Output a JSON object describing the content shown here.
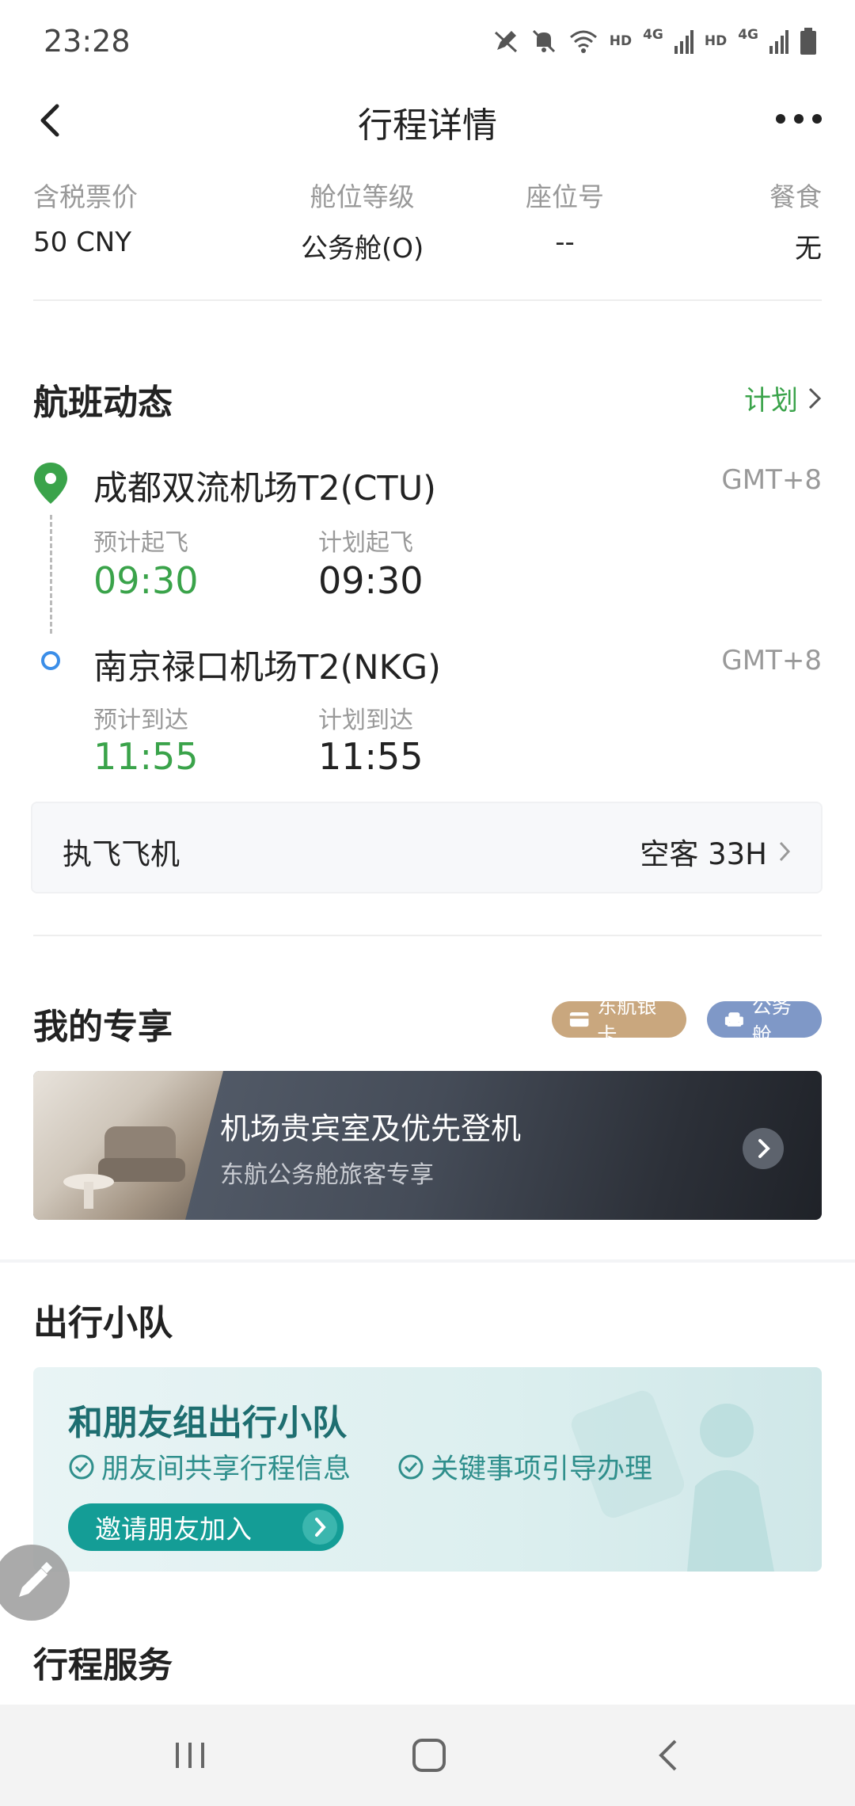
{
  "status_bar": {
    "time": "23:28",
    "icons": [
      "pen-icon",
      "mute-icon",
      "wifi-icon",
      "signal-icon",
      "signal-icon",
      "battery-icon"
    ],
    "hd1": "HD",
    "net1": "4G",
    "hd2": "HD",
    "net2": "4G"
  },
  "header": {
    "title": "行程详情"
  },
  "ticket": {
    "price_label": "含税票价",
    "price_value": "50 CNY",
    "class_label": "舱位等级",
    "class_value": "公务舱(O)",
    "seat_label": "座位号",
    "seat_value": "--",
    "meal_label": "餐食",
    "meal_value": "无"
  },
  "flight_status": {
    "title": "航班动态",
    "plan_link": "计划",
    "departure": {
      "airport": "成都双流机场T2(CTU)",
      "tz": "GMT+8",
      "est_label": "预计起飞",
      "est_time": "09:30",
      "plan_label": "计划起飞",
      "plan_time": "09:30"
    },
    "arrival": {
      "airport": "南京禄口机场T2(NKG)",
      "tz": "GMT+8",
      "est_label": "预计到达",
      "est_time": "11:55",
      "plan_label": "计划到达",
      "plan_time": "11:55"
    },
    "aircraft_label": "执飞飞机",
    "aircraft_value": "空客 33H"
  },
  "perks": {
    "title": "我的专享",
    "badge_silver": "东航银卡",
    "badge_business": "公务舱",
    "lounge_title": "机场贵宾室及优先登机",
    "lounge_subtitle": "东航公务舱旅客专享"
  },
  "squad": {
    "title": "出行小队",
    "card_title": "和朋友组出行小队",
    "feature1": "朋友间共享行程信息",
    "feature2": "关键事项引导办理",
    "invite_button": "邀请朋友加入"
  },
  "services": {
    "title": "行程服务"
  },
  "colors": {
    "accent_green": "#3aa34a",
    "teal": "#149d96",
    "silver_badge": "#c9a77e",
    "business_badge": "#7f98c7"
  }
}
